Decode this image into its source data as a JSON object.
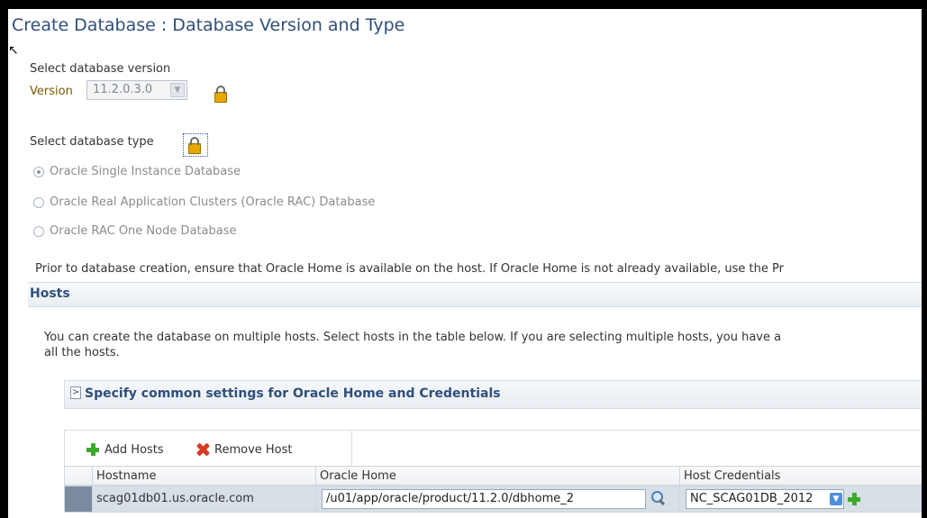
{
  "page": {
    "title": "Create Database : Database Version and Type"
  },
  "version": {
    "section_label": "Select database version",
    "field_label": "Version",
    "selected_value": "11.2.0.3.0"
  },
  "db_type": {
    "section_label": "Select database type",
    "options": [
      {
        "label": "Oracle Single Instance Database",
        "selected": true
      },
      {
        "label": "Oracle Real Application Clusters (Oracle RAC) Database",
        "selected": false
      },
      {
        "label": "Oracle RAC One Node Database",
        "selected": false
      }
    ]
  },
  "notice": "Prior to database creation, ensure that Oracle Home is available on the host. If Oracle Home is not already available, use the Pr",
  "hosts": {
    "header": "Hosts",
    "description_line1": "You can create the database on multiple hosts. Select hosts in the table below. If you are selecting multiple hosts, you have a",
    "description_line2": "all the hosts.",
    "common_settings_label": "Specify common settings for Oracle Home and Credentials",
    "toolbar": {
      "add_label": "Add Hosts",
      "remove_label": "Remove Host"
    },
    "columns": [
      "Hostname",
      "Oracle Home",
      "Host Credentials"
    ],
    "rows": [
      {
        "hostname": "scag01db01.us.oracle.com",
        "oracle_home": "/u01/app/oracle/product/11.2.0/dbhome_2",
        "credentials": "NC_SCAG01DB_2012"
      }
    ]
  },
  "icons": {
    "lock": "lock-icon",
    "add": "plus-icon",
    "remove": "x-icon",
    "search": "search-icon",
    "expand": "chevron-right-icon"
  },
  "colors": {
    "title": "#2f4f7a",
    "version_label": "#7a5a00",
    "selected_row": "#d7dfe7"
  }
}
